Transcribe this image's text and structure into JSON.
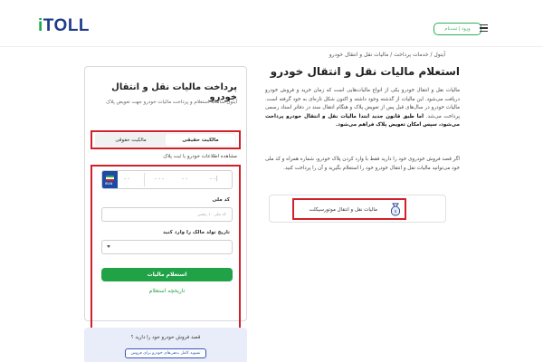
{
  "header": {
    "logo_i": "i",
    "logo_text": "TOLL",
    "login_label": "ورود | ثبت‌نام"
  },
  "breadcrumb": "آیتول / خدمات پرداخت / مالیات نقل و انتقال خودرو",
  "form": {
    "title": "پرداخت مالیات نقل و انتقال خودرو",
    "subtitle": "آیتول سامانه استعلام و پرداخت مالیات خودرو جهت تعویض پلاک",
    "tabs": [
      {
        "label": "مالکیت حقیقی",
        "active": true
      },
      {
        "label": "مالکیت حقوقی",
        "active": false
      }
    ],
    "plate_label": "مشاهده اطلاعات خودرو با ثبت پلاک",
    "plate": {
      "flag_text": "IRAN",
      "seg1": "- -",
      "seg2": "- - -",
      "seg3": "- -",
      "seg4": "- -|"
    },
    "national_code_label": "کد ملی",
    "national_code_placeholder": "کد ملی ۱۰ رقمی",
    "birth_label": "تاریخ تولد مالک را وارد کنید",
    "birth_value": "",
    "submit_label": "استعلام مالیات",
    "history_label": "تاریخچه استعلام"
  },
  "promo": {
    "text": "قصد فروش خودرو خود را دارید ؟",
    "button": "تسویه کامل بدهی‌های خودرو برای فروش"
  },
  "content": {
    "title": "استعلام مالیات نقل و انتقال خودرو",
    "para1": "مالیات نقل و انتقال خودرو یکی از انواع مالیات‌هایی است که زمان خرید و فروش خودرو دریافت می‌شود. این مالیات از گذشته وجود داشته و اکنون شکل تازه‌ای به خود گرفته است. مالیات خودرو در سال‌های قبل پس از تعویض پلاک و هنگام انتقال سند در دفاتر اسناد رسمی پرداخت می‌شد.",
    "para1_bold": "اما طبق قانون جدید ابتدا مالیات نقل و انتقال خودرو پرداخت می‌شود، سپس امکان تعویض پلاک فراهم می‌شود.",
    "para2": "اگر قصد فروش خودروی خود را دارید فقط با وارد کردن پلاک خودرو، شماره همراه و کد ملی خود می‌توانید مالیات نقل و انتقال خودرو خود را استعلام بگیرید و آن را پرداخت کنید.",
    "service_label": "مالیات نقل و انتقال موتورسیکلت"
  },
  "colors": {
    "brand_green": "#22a247",
    "brand_blue": "#1f3b8c",
    "highlight_red": "#d0202a"
  }
}
